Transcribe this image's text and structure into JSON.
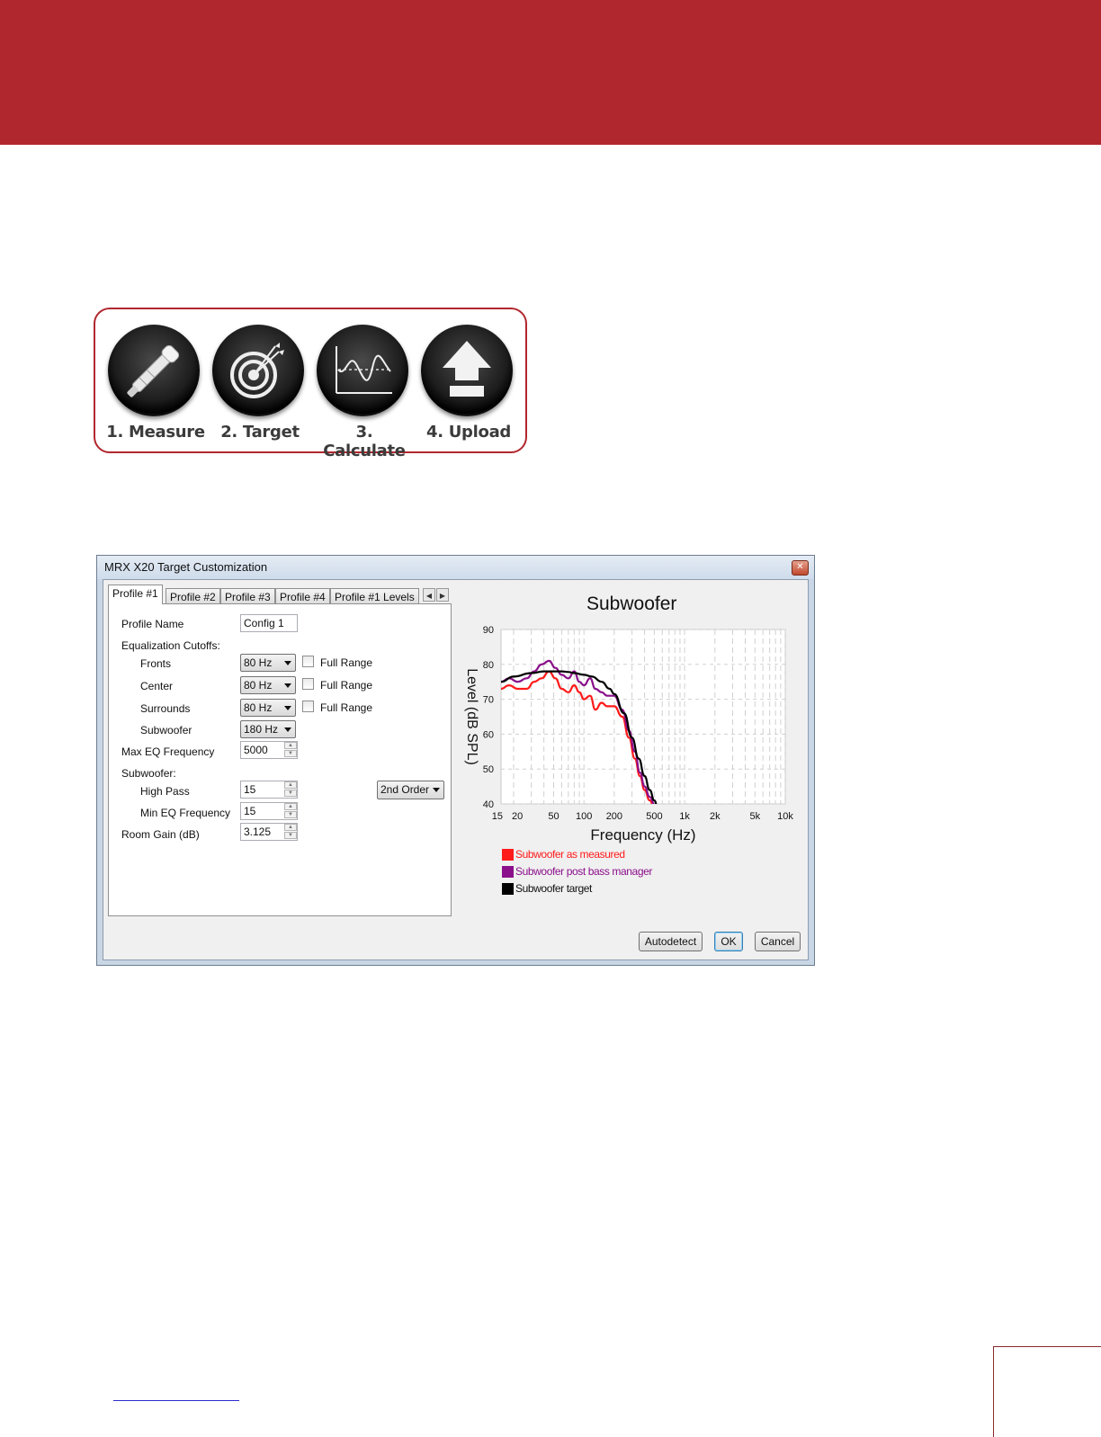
{
  "steps": [
    {
      "label": "1. Measure",
      "icon": "microphone-icon"
    },
    {
      "label": "2. Target",
      "icon": "target-icon"
    },
    {
      "label": "3. Calculate",
      "icon": "curve-graph-icon"
    },
    {
      "label": "4. Upload",
      "icon": "upload-arrow-icon"
    }
  ],
  "dialog": {
    "title": "MRX X20 Target Customization",
    "tabs": [
      "Profile #1",
      "Profile #2",
      "Profile #3",
      "Profile #4",
      "Profile #1 Levels"
    ],
    "form": {
      "profile_name_label": "Profile Name",
      "profile_name_value": "Config 1",
      "eq_cutoffs_label": "Equalization Cutoffs:",
      "fronts_label": "Fronts",
      "fronts_value": "80 Hz",
      "center_label": "Center",
      "center_value": "80 Hz",
      "surrounds_label": "Surrounds",
      "surrounds_value": "80 Hz",
      "subwoofer_label": "Subwoofer",
      "subwoofer_value": "180 Hz",
      "full_range_label": "Full Range",
      "max_eq_label": "Max EQ Frequency",
      "max_eq_value": "5000",
      "subwoofer_section_label": "Subwoofer:",
      "high_pass_label": "High Pass",
      "high_pass_value": "15",
      "order_value": "2nd Order",
      "min_eq_label": "Min EQ Frequency",
      "min_eq_value": "15",
      "room_gain_label": "Room Gain (dB)",
      "room_gain_value": "3.125"
    },
    "buttons": {
      "autodetect": "Autodetect",
      "ok": "OK",
      "cancel": "Cancel"
    }
  },
  "chart_data": {
    "type": "line",
    "title": "Subwoofer",
    "xlabel": "Frequency (Hz)",
    "ylabel": "Level (dB SPL)",
    "x_scale": "log",
    "xlim": [
      15,
      10000
    ],
    "ylim": [
      40,
      90
    ],
    "grid": true,
    "legend_position": "bottom-left",
    "x_ticks": [
      {
        "value": 15,
        "label": "15"
      },
      {
        "value": 20,
        "label": "20"
      },
      {
        "value": 50,
        "label": "50"
      },
      {
        "value": 100,
        "label": "100"
      },
      {
        "value": 200,
        "label": "200"
      },
      {
        "value": 500,
        "label": "500"
      },
      {
        "value": 1000,
        "label": "1k"
      },
      {
        "value": 2000,
        "label": "2k"
      },
      {
        "value": 5000,
        "label": "5k"
      },
      {
        "value": 10000,
        "label": "10k"
      }
    ],
    "y_ticks": [
      40,
      50,
      60,
      70,
      80,
      90
    ],
    "series": [
      {
        "name": "Subwoofer as measured",
        "color": "#ff1a1a",
        "x": [
          15,
          18,
          22,
          27,
          32,
          38,
          45,
          52,
          60,
          70,
          80,
          90,
          100,
          115,
          130,
          150,
          170,
          200,
          240,
          280,
          320,
          360,
          400,
          450,
          500
        ],
        "y": [
          73,
          74,
          73,
          73,
          75,
          76,
          78,
          76,
          73,
          72,
          74,
          72,
          70,
          71,
          67,
          69,
          68,
          68,
          65,
          59,
          53,
          48,
          44,
          41,
          39
        ]
      },
      {
        "name": "Subwoofer post bass manager",
        "color": "#8b0f8b",
        "x": [
          15,
          18,
          22,
          27,
          32,
          38,
          45,
          52,
          60,
          70,
          80,
          90,
          100,
          115,
          130,
          150,
          170,
          200,
          240,
          280,
          320,
          360,
          400,
          450,
          500
        ],
        "y": [
          75,
          76,
          75,
          76,
          78,
          80,
          81,
          79,
          77,
          76,
          78,
          75,
          74,
          76,
          73,
          72,
          71,
          71,
          67,
          61,
          55,
          49,
          45,
          42,
          40
        ]
      },
      {
        "name": "Subwoofer target",
        "color": "#000000",
        "x": [
          15,
          20,
          30,
          40,
          50,
          60,
          70,
          80,
          100,
          120,
          150,
          180,
          200,
          250,
          300,
          350,
          400,
          450,
          500,
          550
        ],
        "y": [
          75,
          76.5,
          77.5,
          78,
          78,
          78,
          77.8,
          77.5,
          77,
          76.5,
          75,
          73,
          71.5,
          66,
          59,
          53,
          48,
          44,
          41,
          38
        ]
      }
    ]
  }
}
